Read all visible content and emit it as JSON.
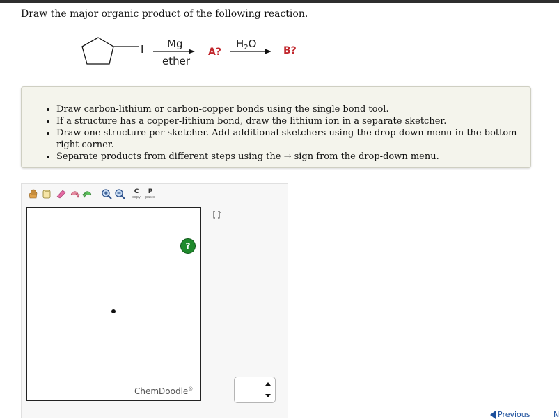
{
  "question": "Draw the major organic product of the following reaction.",
  "reaction": {
    "leaving_group": "I",
    "reagent1_top": "Mg",
    "reagent1_bottom": "ether",
    "intermediate": "A?",
    "reagent2_top_main": "H",
    "reagent2_top_sub": "2",
    "reagent2_top_end": "O",
    "product": "B?"
  },
  "instructions": [
    "Draw carbon-lithium or carbon-copper bonds using the single bond tool.",
    "If a structure has a copper-lithium bond, draw the lithium ion in a separate sketcher.",
    "Draw one structure per sketcher. Add additional sketchers using the drop-down menu in the bottom right corner.",
    "Separate products from different steps using the → sign from the drop-down menu."
  ],
  "sketcher": {
    "toolbar_row1": [
      "hand-icon",
      "eraser-icon",
      "lasso-icon",
      "rotate-icon",
      "zoom-in-icon",
      "zoom-out-icon",
      "copy-icon",
      "paste-icon"
    ],
    "copy_label": "copy",
    "paste_label": "paste",
    "copy_letter": "C",
    "paste_letter": "P",
    "element_label": "C",
    "help_label": "?",
    "brand_name": "ChemDoodle",
    "brand_mark": "®"
  },
  "nav": {
    "previous": "Previous",
    "next_fragment": "N"
  },
  "colors": {
    "unknown_red": "#c1272d",
    "help_green": "#1f8a2c",
    "link_blue": "#1c4f9c"
  }
}
